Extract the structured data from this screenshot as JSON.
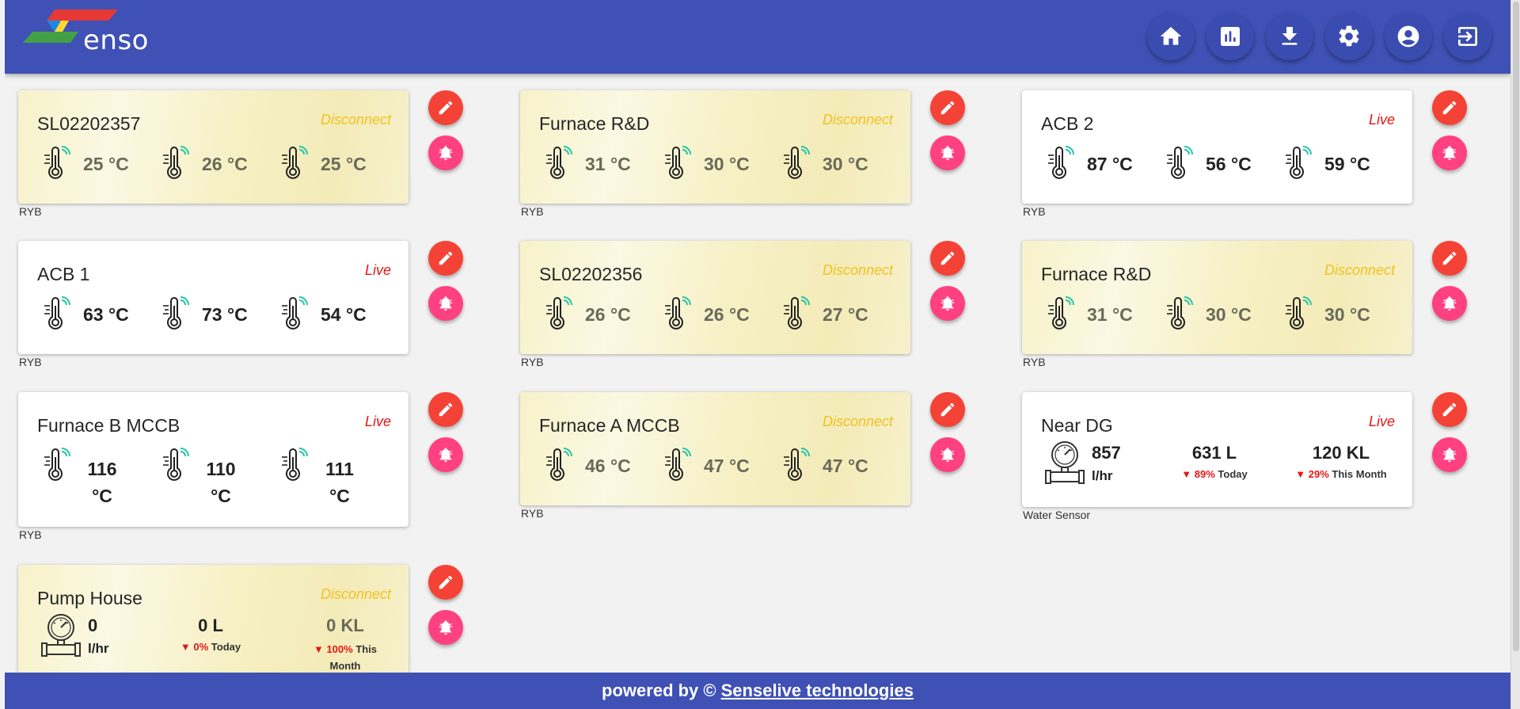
{
  "logo": {
    "text": "enso"
  },
  "nav": [
    {
      "name": "home-icon"
    },
    {
      "name": "report-icon"
    },
    {
      "name": "download-icon"
    },
    {
      "name": "settings-icon"
    },
    {
      "name": "account-icon"
    },
    {
      "name": "logout-icon"
    }
  ],
  "cards": [
    {
      "title": "SL02202357",
      "status": "Disconnect",
      "type": "RYB",
      "values": [
        "25 °C",
        "26 °C",
        "25 °C"
      ]
    },
    {
      "title": "Furnace R&D",
      "status": "Disconnect",
      "type": "RYB",
      "values": [
        "31 °C",
        "30 °C",
        "30 °C"
      ]
    },
    {
      "title": "ACB 2",
      "status": "Live",
      "type": "RYB",
      "values": [
        "87 °C",
        "56 °C",
        "59 °C"
      ]
    },
    {
      "title": "ACB 1",
      "status": "Live",
      "type": "RYB",
      "values": [
        "63 °C",
        "73 °C",
        "54 °C"
      ]
    },
    {
      "title": "SL02202356",
      "status": "Disconnect",
      "type": "RYB",
      "values": [
        "26 °C",
        "26 °C",
        "27 °C"
      ]
    },
    {
      "title": "Furnace R&D",
      "status": "Disconnect",
      "type": "RYB",
      "values": [
        "31 °C",
        "30 °C",
        "30 °C"
      ]
    },
    {
      "title": "Furnace B MCCB",
      "status": "Live",
      "type": "RYB",
      "values": [
        "116 °C",
        "110 °C",
        "111 °C"
      ]
    },
    {
      "title": "Furnace A MCCB",
      "status": "Disconnect",
      "type": "RYB",
      "values": [
        "46 °C",
        "47 °C",
        "47 °C"
      ]
    }
  ],
  "water_cards": [
    {
      "title": "Near DG",
      "status": "Live",
      "type": "Water Sensor",
      "flow": "857",
      "flow_unit": "l/hr",
      "today_value": "631 L",
      "today_pct": "89%",
      "today_label": "Today",
      "month_value": "120 KL",
      "month_pct": "29%",
      "month_label": "This Month"
    },
    {
      "title": "Pump House",
      "status": "Disconnect",
      "type": "",
      "flow": "0",
      "flow_unit": "l/hr",
      "today_value": "0 L",
      "today_pct": "0%",
      "today_label": "Today",
      "month_value": "0 KL",
      "month_pct": "100%",
      "month_label": "This Month"
    }
  ],
  "footer": {
    "prefix": "powered by ©",
    "link": "Senselive technologies"
  },
  "colors": {
    "header": "#3f51b5",
    "edit": "#f44336",
    "alarm": "#ff4081",
    "live": "#e41717",
    "disconnect": "#f0c21e"
  }
}
